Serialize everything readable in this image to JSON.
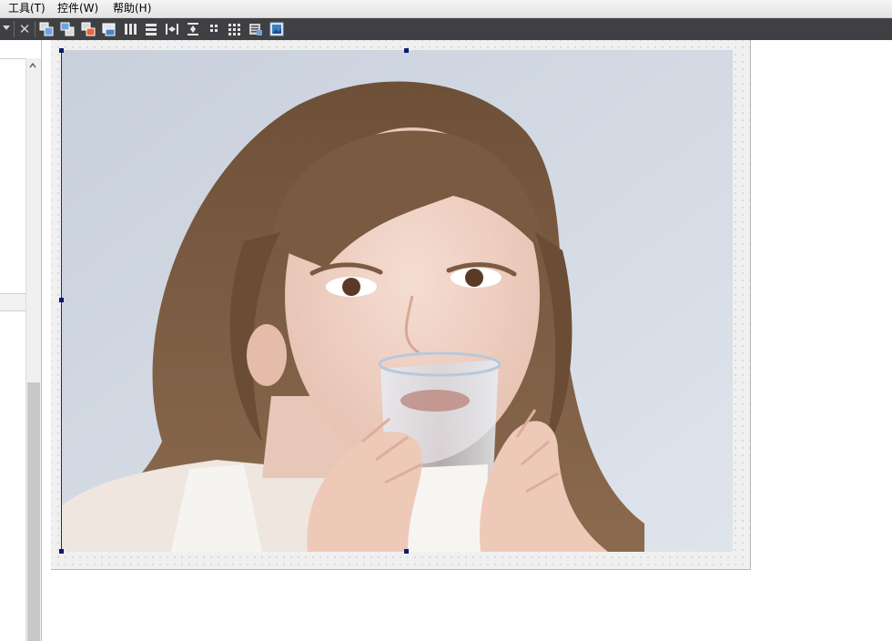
{
  "menubar": {
    "items": [
      {
        "label": "工具(T)"
      },
      {
        "label": "控件(W)"
      },
      {
        "label": "帮助(H)"
      }
    ]
  },
  "toolbar": {
    "buttons": [
      {
        "icon": "bring-to-front-icon"
      },
      {
        "icon": "send-to-back-icon"
      },
      {
        "icon": "tab-order-icon"
      },
      {
        "icon": "lock-controls-icon"
      },
      {
        "icon": "align-columns-icon"
      },
      {
        "icon": "align-rows-icon"
      },
      {
        "icon": "horizontal-spacing-icon"
      },
      {
        "icon": "vertical-spacing-icon"
      },
      {
        "icon": "grid-small-icon"
      },
      {
        "icon": "grid-large-icon"
      },
      {
        "icon": "properties-icon"
      },
      {
        "icon": "picture-icon"
      }
    ]
  },
  "designer": {
    "image": {
      "subject": "picture-box-photo"
    }
  },
  "colors": {
    "toolbar_bg": "#3f4043",
    "selection_handle": "#0a1a6e",
    "surface_bg": "#f0f0f0"
  }
}
